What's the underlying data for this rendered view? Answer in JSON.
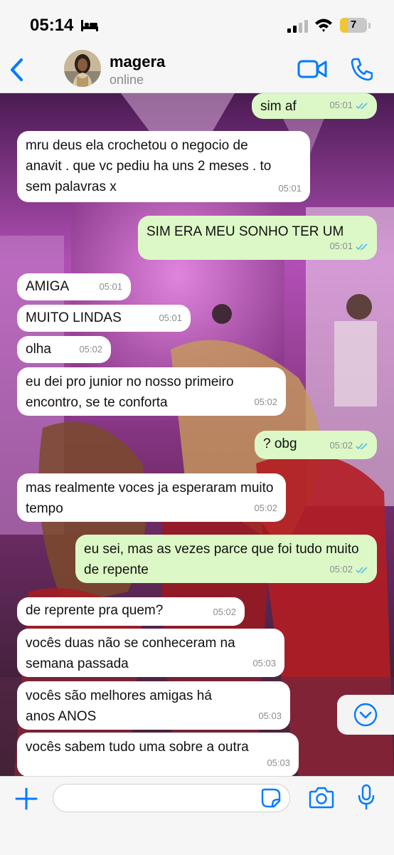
{
  "status_bar": {
    "time": "05:14",
    "battery": "7"
  },
  "header": {
    "name": "magera",
    "status": "online"
  },
  "messages": [
    {
      "dir": "out",
      "text": "sim af",
      "time": "05:01",
      "read": true
    },
    {
      "dir": "in",
      "text": "mru deus ela crochetou o negocio de anavit . que vc pediu ha uns 2 meses . to sem palavras x",
      "time": "05:01"
    },
    {
      "dir": "out",
      "text": "SIM ERA MEU SONHO TER UM",
      "time": "05:01",
      "read": true
    },
    {
      "dir": "in",
      "text": "AMIGA",
      "time": "05:01"
    },
    {
      "dir": "in",
      "text": "MUITO LINDAS",
      "time": "05:01"
    },
    {
      "dir": "in",
      "text": "olha",
      "time": "05:02"
    },
    {
      "dir": "in",
      "text": "eu dei pro junior no nosso primeiro encontro, se te conforta",
      "time": "05:02"
    },
    {
      "dir": "out",
      "text": "? obg",
      "time": "05:02",
      "read": true
    },
    {
      "dir": "in",
      "text": "mas realmente voces ja esperaram muito tempo",
      "time": "05:02"
    },
    {
      "dir": "out",
      "text": "eu sei, mas as vezes parce que foi tudo muito de repente",
      "time": "05:02",
      "read": true
    },
    {
      "dir": "in",
      "text": "de reprente pra quem?",
      "time": "05:02"
    },
    {
      "dir": "in",
      "text": "vocês duas não se conheceram na semana passada",
      "time": "05:03"
    },
    {
      "dir": "in",
      "text": "vocês são melhores amigas há anos ANOS",
      "time": "05:03"
    },
    {
      "dir": "in",
      "text": "vocês sabem tudo uma sobre a outra",
      "time": "05:03"
    }
  ],
  "colors": {
    "accent": "#007aff",
    "outgoing": "#dcf8c6",
    "incoming": "#ffffff",
    "read_tick": "#53bdeb"
  },
  "icons": [
    "bed-icon",
    "signal-icon",
    "wifi-icon",
    "back-icon",
    "video-call-icon",
    "phone-icon",
    "scroll-down-icon",
    "plus-icon",
    "sticker-icon",
    "camera-icon",
    "microphone-icon"
  ]
}
